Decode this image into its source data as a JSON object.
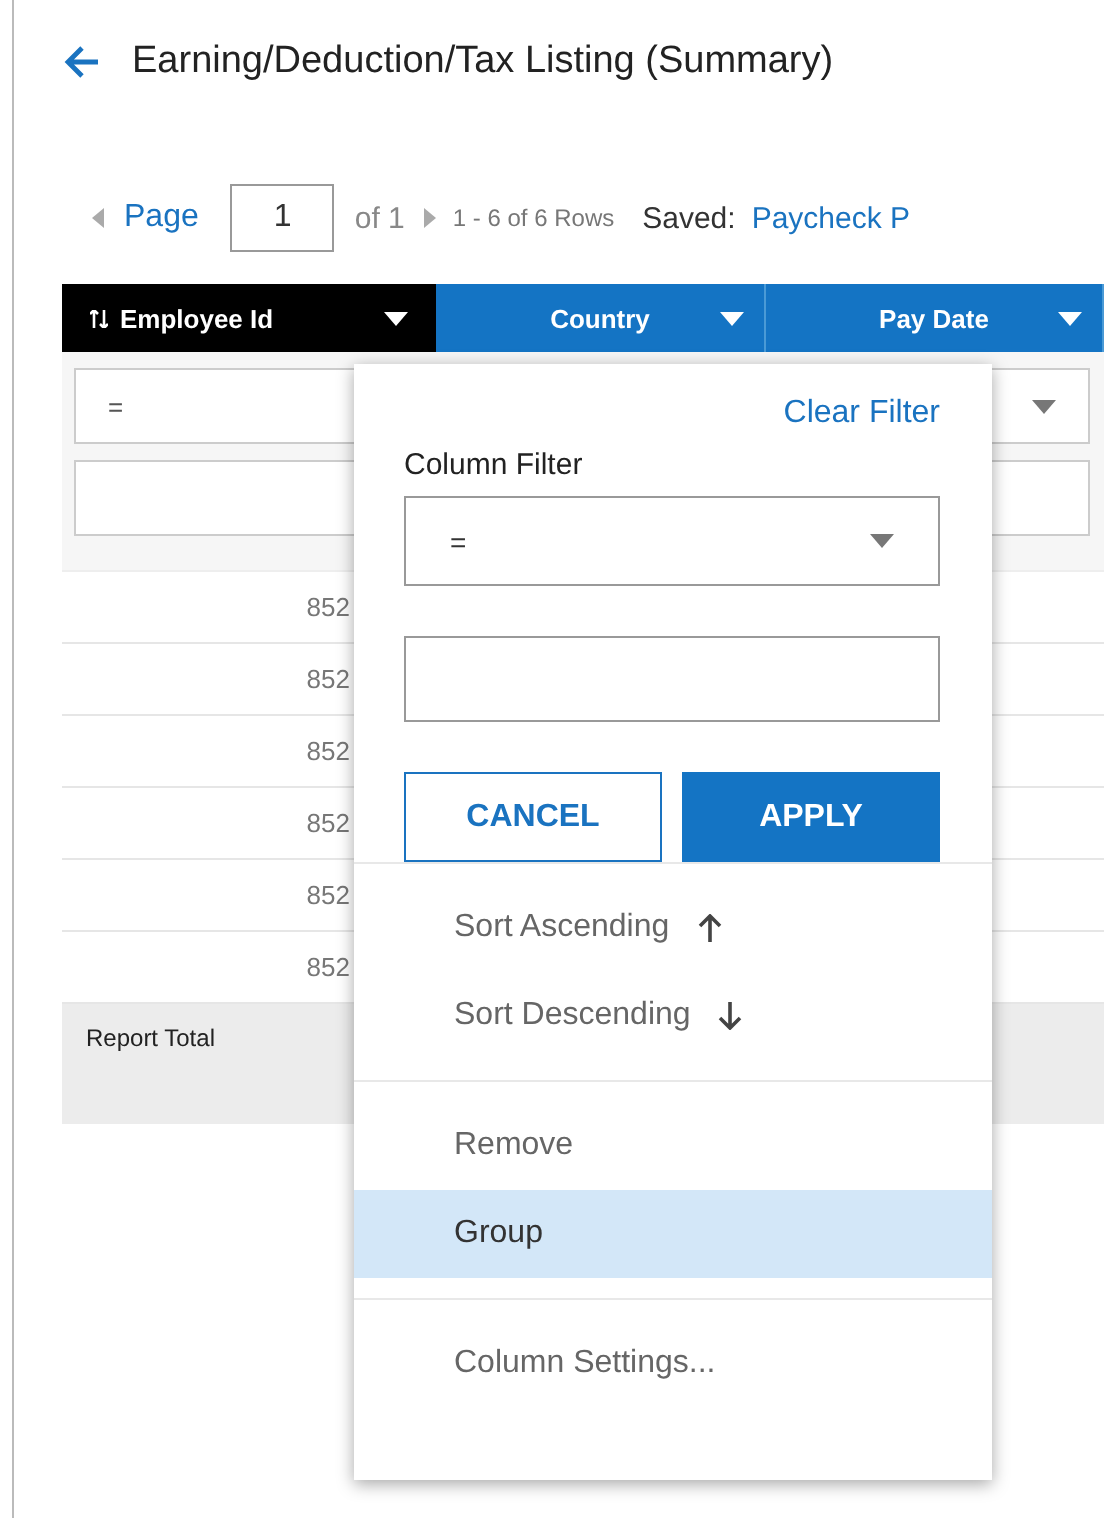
{
  "title": "Earning/Deduction/Tax Listing (Summary)",
  "pager": {
    "page_label": "Page",
    "page_value": "1",
    "of": "of 1",
    "rows_info": "1 - 6 of 6 Rows",
    "saved_label": "Saved:",
    "saved_value": "Paycheck P"
  },
  "columns": [
    {
      "label": "Employee Id",
      "active": true,
      "sorted": true
    },
    {
      "label": "Country",
      "active": false,
      "sorted": false
    },
    {
      "label": "Pay Date",
      "active": false,
      "sorted": false
    }
  ],
  "filter": {
    "operator": "="
  },
  "rows": [
    {
      "employee_id": "852"
    },
    {
      "employee_id": "852"
    },
    {
      "employee_id": "852"
    },
    {
      "employee_id": "852"
    },
    {
      "employee_id": "852"
    },
    {
      "employee_id": "852"
    }
  ],
  "total_label": "Report Total",
  "popup": {
    "clear_filter": "Clear Filter",
    "column_filter_label": "Column Filter",
    "operator": "=",
    "cancel": "CANCEL",
    "apply": "APPLY",
    "sections": [
      [
        {
          "label": "Sort Ascending",
          "kind": "sort_ascending",
          "selected": false
        },
        {
          "label": "Sort Descending",
          "kind": "sort_descending",
          "selected": false
        }
      ],
      [
        {
          "label": "Remove",
          "kind": "plain",
          "selected": false
        },
        {
          "label": "Group",
          "kind": "plain",
          "selected": true
        }
      ],
      [
        {
          "label": "Column Settings...",
          "kind": "plain",
          "selected": false
        }
      ]
    ]
  }
}
